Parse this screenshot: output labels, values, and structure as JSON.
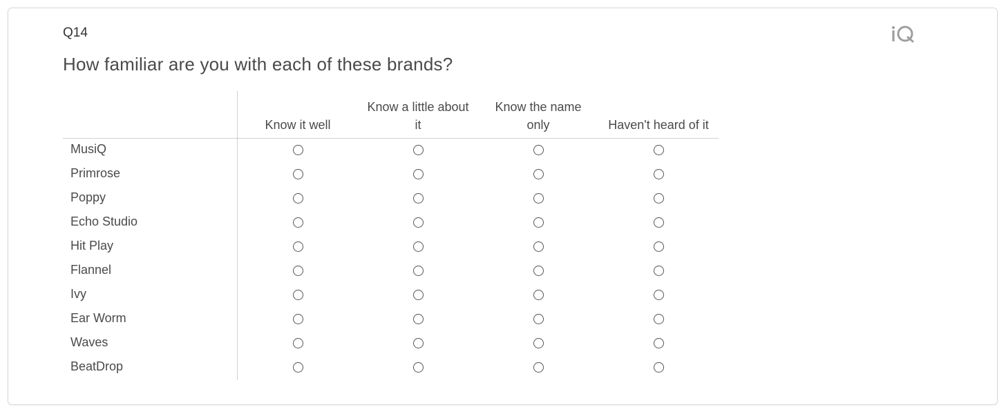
{
  "question": {
    "id": "Q14",
    "text": "How familiar are you with each of these brands?"
  },
  "logo": {
    "text": "iQ",
    "icon": "qualtrics-iq-logo"
  },
  "columns": [
    {
      "line1": "",
      "line2": "Know it well"
    },
    {
      "line1": "Know a little about",
      "line2": "it"
    },
    {
      "line1": "Know the name",
      "line2": "only"
    },
    {
      "line1": "",
      "line2": "Haven't heard of it"
    }
  ],
  "rows": [
    "MusiQ",
    "Primrose",
    "Poppy",
    "Echo Studio",
    "Hit Play",
    "Flannel",
    "Ivy",
    "Ear Worm",
    "Waves",
    "BeatDrop"
  ],
  "colors": {
    "border": "#d9d9d9",
    "text": "#4a4a4a",
    "logo": "#9e9e9e"
  }
}
